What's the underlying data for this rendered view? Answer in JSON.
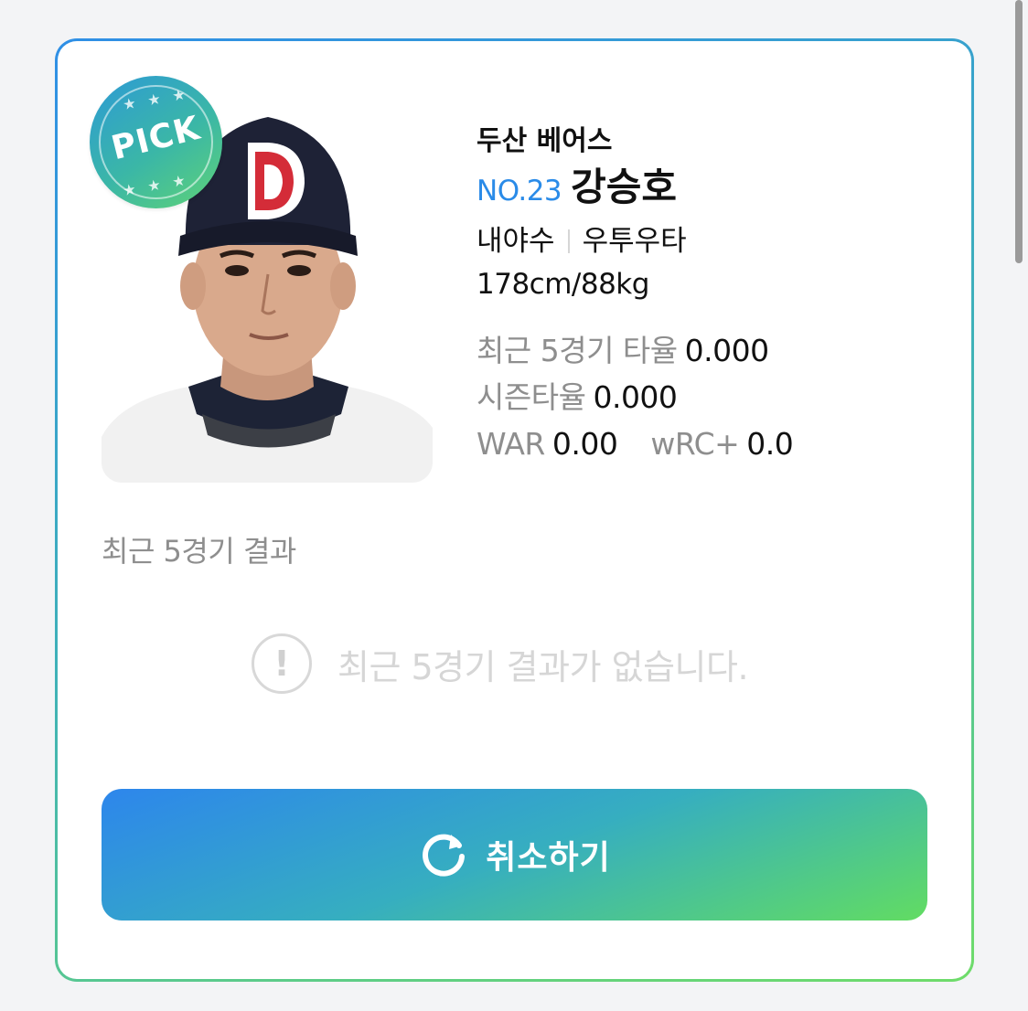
{
  "badge": {
    "label": "PICK"
  },
  "player": {
    "team": "두산 베어스",
    "number": "NO.23",
    "name": "강승호",
    "position": "내야수",
    "bats_throws": "우투우타",
    "body": "178cm/88kg"
  },
  "stats": {
    "recent5_avg_label": "최근 5경기 타율",
    "recent5_avg_value": "0.000",
    "season_avg_label": "시즌타율",
    "season_avg_value": "0.000",
    "war_label": "WAR",
    "war_value": "0.00",
    "wrc_label": "wRC+",
    "wrc_value": "0.0"
  },
  "recent": {
    "title": "최근 5경기 결과",
    "empty_message": "최근 5경기 결과가 없습니다."
  },
  "actions": {
    "cancel_label": "취소하기"
  },
  "colors": {
    "accent_blue": "#2a8be8",
    "gradient_start": "#2d86ec",
    "gradient_end": "#62dc62"
  },
  "icons": {
    "badge": "pick-badge",
    "empty": "exclamation-circle-icon",
    "cancel": "refresh-icon"
  }
}
